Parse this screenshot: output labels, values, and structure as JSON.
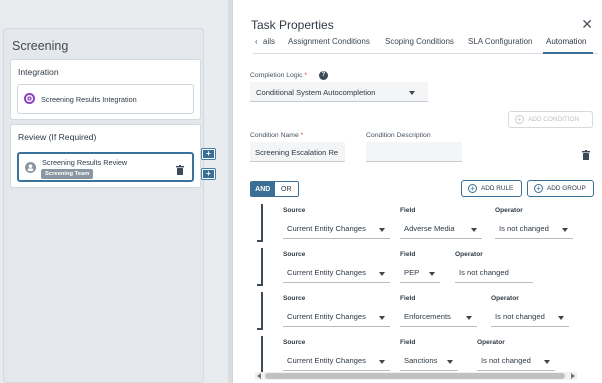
{
  "workflow": {
    "stage_title": "Screening",
    "sections": [
      {
        "title": "Integration",
        "task": {
          "label": "Screening Results Integration"
        }
      },
      {
        "title": "Review (If Required)",
        "task": {
          "label": "Screening Results Review",
          "badge": "Screening Team"
        }
      }
    ],
    "side_buttons": [
      "+",
      "+"
    ]
  },
  "panel": {
    "title": "Task Properties",
    "close": "✕",
    "tabs": [
      {
        "label": "ails"
      },
      {
        "label": "Assignment Conditions"
      },
      {
        "label": "Scoping Conditions"
      },
      {
        "label": "SLA Configuration"
      },
      {
        "label": "Automation",
        "active": true
      }
    ],
    "tab_prev": "‹",
    "completion_logic": {
      "label": "Completion Logic",
      "required": "*",
      "help": "?",
      "value": "Conditional System Autocompletion"
    },
    "add_condition": "ADD CONDITION",
    "condition_name": {
      "label": "Condition Name",
      "required": "*",
      "value": "Screening Escalation Re"
    },
    "condition_description": {
      "label": "Condition Description",
      "value": ""
    },
    "logic_toggle": {
      "and": "AND",
      "or": "OR",
      "selected": "AND"
    },
    "add_rule": "ADD RULE",
    "add_group": "ADD GROUP",
    "rule_labels": {
      "source": "Source",
      "field": "Field",
      "operator": "Operator"
    },
    "rules": [
      {
        "source": "Current Entity Changes",
        "field": "Adverse Media",
        "operator": "Is not changed"
      },
      {
        "source": "Current Entity Changes",
        "field": "PEP",
        "operator": "Is not changed"
      },
      {
        "source": "Current Entity Changes",
        "field": "Enforcements",
        "operator": "Is not changed"
      },
      {
        "source": "Current Entity Changes",
        "field": "Sanctions",
        "operator": "Is not changed"
      }
    ]
  },
  "colors": {
    "accent": "#3b6e95",
    "required": "#d33c3c",
    "integration_icon": "#8a3fbf",
    "review_icon": "#8a96a1"
  },
  "icons": [
    "gear-icon",
    "person-icon",
    "trash-icon",
    "close-icon",
    "help-icon",
    "plus-circle-icon",
    "caret-down-icon",
    "chevron-left-icon"
  ]
}
